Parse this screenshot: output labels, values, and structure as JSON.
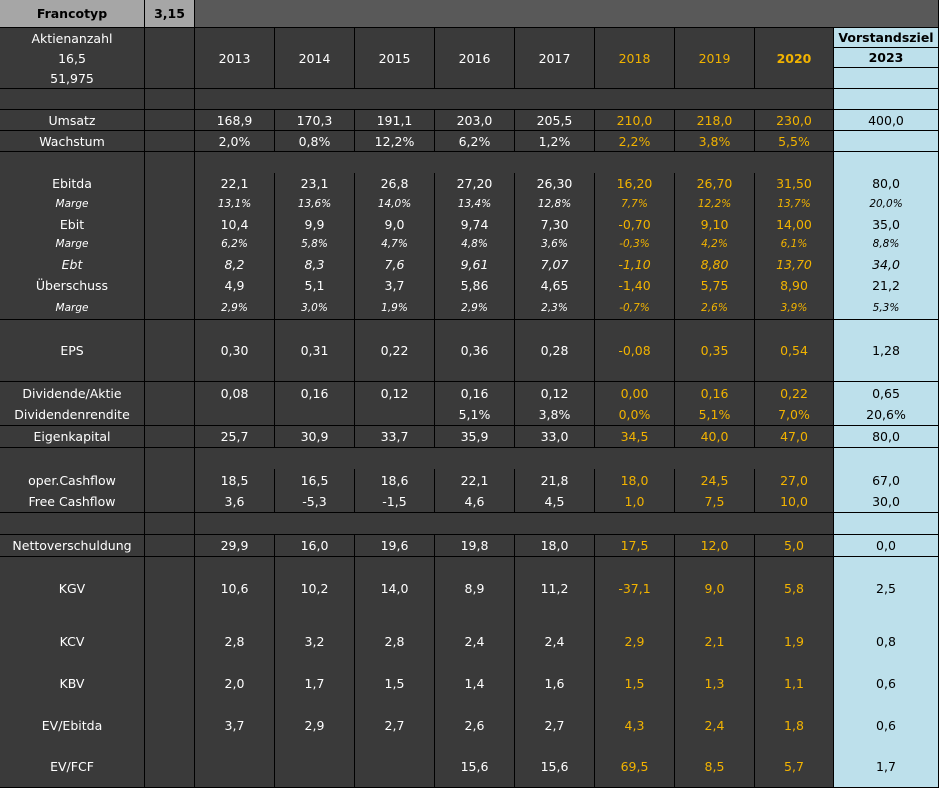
{
  "header": {
    "title": "Francotyp",
    "price": "3,15",
    "shares_label": "Aktienanzahl",
    "shares_count": "16,5",
    "market_cap": "51,975",
    "target_label": "Vorstandsziel",
    "target_year": "2023"
  },
  "years": [
    "2013",
    "2014",
    "2015",
    "2016",
    "2017",
    "2018",
    "2019",
    "2020"
  ],
  "rows": [
    {
      "key": "umsatz",
      "label": "Umsatz",
      "values": [
        "168,9",
        "170,3",
        "191,1",
        "203,0",
        "205,5",
        "210,0",
        "218,0",
        "230,0"
      ],
      "target": "400,0"
    },
    {
      "key": "wachstum",
      "label": "Wachstum",
      "values": [
        "2,0%",
        "0,8%",
        "12,2%",
        "6,2%",
        "1,2%",
        "2,2%",
        "3,8%",
        "5,5%"
      ],
      "target": ""
    },
    {
      "key": "ebitda",
      "label": "Ebitda",
      "values": [
        "22,1",
        "23,1",
        "26,8",
        "27,20",
        "26,30",
        "16,20",
        "26,70",
        "31,50"
      ],
      "target": "80,0"
    },
    {
      "key": "marge_ebitda",
      "label": "Marge",
      "values": [
        "13,1%",
        "13,6%",
        "14,0%",
        "13,4%",
        "12,8%",
        "7,7%",
        "12,2%",
        "13,7%"
      ],
      "target": "20,0%"
    },
    {
      "key": "ebit",
      "label": "Ebit",
      "values": [
        "10,4",
        "9,9",
        "9,0",
        "9,74",
        "7,30",
        "-0,70",
        "9,10",
        "14,00"
      ],
      "target": "35,0"
    },
    {
      "key": "marge_ebit",
      "label": "Marge",
      "values": [
        "6,2%",
        "5,8%",
        "4,7%",
        "4,8%",
        "3,6%",
        "-0,3%",
        "4,2%",
        "6,1%"
      ],
      "target": "8,8%"
    },
    {
      "key": "ebt",
      "label": "Ebt",
      "values": [
        "8,2",
        "8,3",
        "7,6",
        "9,61",
        "7,07",
        "-1,10",
        "8,80",
        "13,70"
      ],
      "target": "34,0"
    },
    {
      "key": "ueberschuss",
      "label": "Überschuss",
      "values": [
        "4,9",
        "5,1",
        "3,7",
        "5,86",
        "4,65",
        "-1,40",
        "5,75",
        "8,90"
      ],
      "target": "21,2"
    },
    {
      "key": "marge_ueber",
      "label": "Marge",
      "values": [
        "2,9%",
        "3,0%",
        "1,9%",
        "2,9%",
        "2,3%",
        "-0,7%",
        "2,6%",
        "3,9%"
      ],
      "target": "5,3%"
    },
    {
      "key": "eps",
      "label": "EPS",
      "values": [
        "0,30",
        "0,31",
        "0,22",
        "0,36",
        "0,28",
        "-0,08",
        "0,35",
        "0,54"
      ],
      "target": "1,28"
    },
    {
      "key": "dividende",
      "label": "Dividende/Aktie",
      "values": [
        "0,08",
        "0,16",
        "0,12",
        "0,16",
        "0,12",
        "0,00",
        "0,16",
        "0,22"
      ],
      "target": "0,65"
    },
    {
      "key": "divrendite",
      "label": "Dividendenrendite",
      "values": [
        "",
        "",
        "",
        "5,1%",
        "3,8%",
        "0,0%",
        "5,1%",
        "7,0%"
      ],
      "target": "20,6%"
    },
    {
      "key": "eigenkapital",
      "label": "Eigenkapital",
      "values": [
        "25,7",
        "30,9",
        "33,7",
        "35,9",
        "33,0",
        "34,5",
        "40,0",
        "47,0"
      ],
      "target": "80,0"
    },
    {
      "key": "opcf",
      "label": "oper.Cashflow",
      "values": [
        "18,5",
        "16,5",
        "18,6",
        "22,1",
        "21,8",
        "18,0",
        "24,5",
        "27,0"
      ],
      "target": "67,0"
    },
    {
      "key": "fcf",
      "label": "Free Cashflow",
      "values": [
        "3,6",
        "-5,3",
        "-1,5",
        "4,6",
        "4,5",
        "1,0",
        "7,5",
        "10,0"
      ],
      "target": "30,0"
    },
    {
      "key": "netto",
      "label": "Nettoverschuldung",
      "values": [
        "29,9",
        "16,0",
        "19,6",
        "19,8",
        "18,0",
        "17,5",
        "12,0",
        "5,0"
      ],
      "target": "0,0"
    },
    {
      "key": "kgv",
      "label": "KGV",
      "values": [
        "10,6",
        "10,2",
        "14,0",
        "8,9",
        "11,2",
        "-37,1",
        "9,0",
        "5,8"
      ],
      "target": "2,5"
    },
    {
      "key": "kcv",
      "label": "KCV",
      "values": [
        "2,8",
        "3,2",
        "2,8",
        "2,4",
        "2,4",
        "2,9",
        "2,1",
        "1,9"
      ],
      "target": "0,8"
    },
    {
      "key": "kbv",
      "label": "KBV",
      "values": [
        "2,0",
        "1,7",
        "1,5",
        "1,4",
        "1,6",
        "1,5",
        "1,3",
        "1,1"
      ],
      "target": "0,6"
    },
    {
      "key": "evebitda",
      "label": "EV/Ebitda",
      "values": [
        "3,7",
        "2,9",
        "2,7",
        "2,6",
        "2,7",
        "4,3",
        "2,4",
        "1,8"
      ],
      "target": "0,6"
    },
    {
      "key": "evfcf",
      "label": "EV/FCF",
      "values": [
        "",
        "",
        "",
        "15,6",
        "15,6",
        "69,5",
        "8,5",
        "5,7"
      ],
      "target": "1,7"
    }
  ],
  "colors": {
    "estimate": "#f2b300",
    "target_bg": "#bde0eb",
    "background": "#3a3a3a"
  }
}
